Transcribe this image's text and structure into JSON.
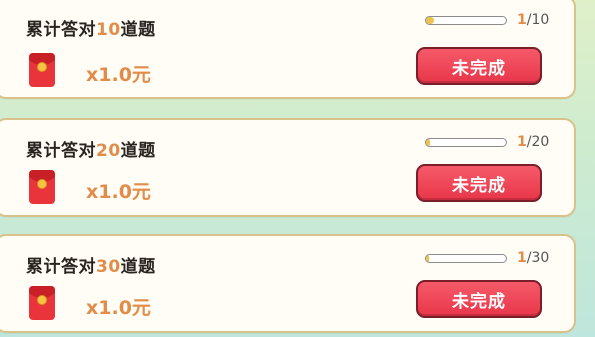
{
  "tasks": [
    {
      "title_prefix": "累计答对",
      "target": "10",
      "title_suffix": "道题",
      "progress_current": "1",
      "progress_total": "/10",
      "progress_fraction": 0.1,
      "reward": "x1.0元",
      "status_label": "未完成"
    },
    {
      "title_prefix": "累计答对",
      "target": "20",
      "title_suffix": "道题",
      "progress_current": "1",
      "progress_total": "/20",
      "progress_fraction": 0.05,
      "reward": "x1.0元",
      "status_label": "未完成"
    },
    {
      "title_prefix": "累计答对",
      "target": "30",
      "title_suffix": "道题",
      "progress_current": "1",
      "progress_total": "/30",
      "progress_fraction": 0.033,
      "reward": "x1.0元",
      "status_label": "未完成"
    }
  ],
  "icons": {
    "reward_icon": "red-envelope-icon"
  },
  "colors": {
    "highlight": "#e28c4a",
    "button": "#e9364a",
    "progress_fill": "#e9c34a"
  }
}
